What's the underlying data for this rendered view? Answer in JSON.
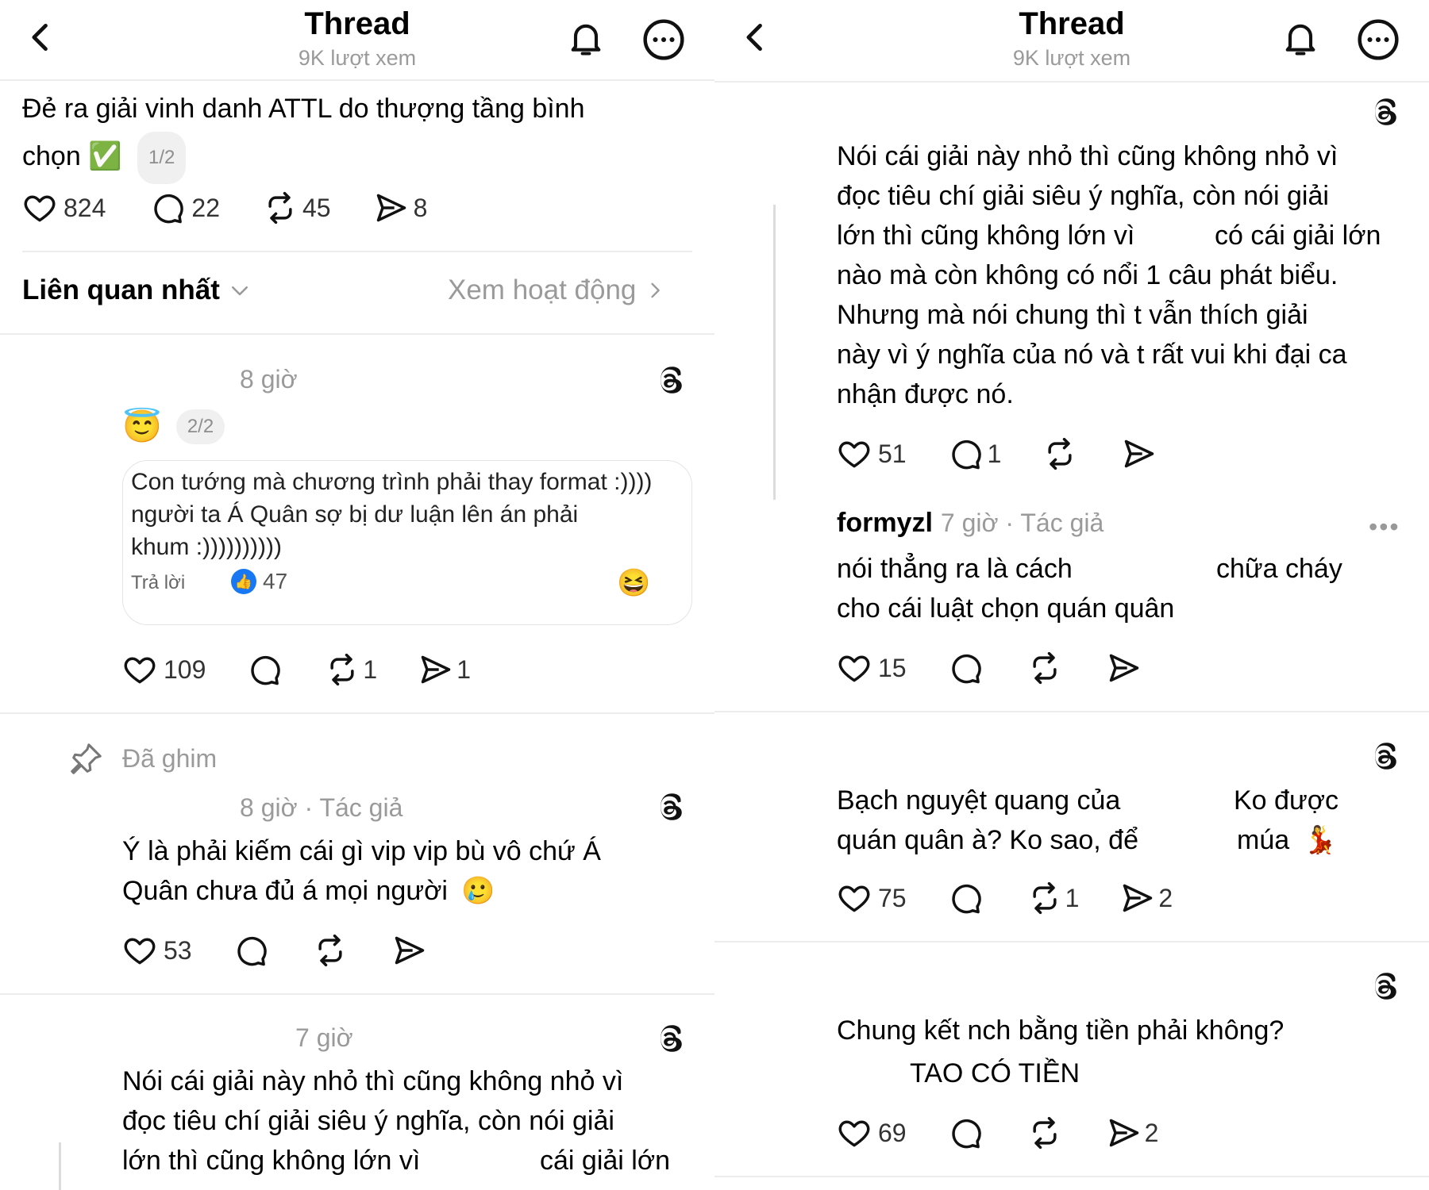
{
  "header": {
    "title": "Thread",
    "subtitle": "9K lượt xem"
  },
  "left": {
    "main_post": {
      "text_line1": "Đẻ ra giải vinh danh ATTL do thượng tầng bình",
      "text_line2": "chọn",
      "emoji": "✅",
      "page": "1/2",
      "likes": "824",
      "replies": "22",
      "reposts": "45",
      "shares": "8"
    },
    "sort": {
      "label": "Liên quan nhất",
      "activity": "Xem hoạt động"
    },
    "reply1": {
      "time": "8 giờ",
      "emoji": "😇",
      "page": "2/2",
      "card_lines": [
        "Con tướng mà chương trình phải thay format :))))",
        "người ta Á Quân sợ bị dư luận lên án phải",
        "khum :))))))))))"
      ],
      "card_reply_label": "Trả lời",
      "card_reaction_count": "47",
      "card_emoji": "😆",
      "likes": "109",
      "reposts": "1",
      "shares": "1"
    },
    "pinned": {
      "label": "Đã ghim",
      "time": "8 giờ · Tác giả",
      "text_lines": [
        "Ý là phải kiếm cái gì vip vip bù vô chứ Á",
        "Quân chưa đủ á mọi người"
      ],
      "emoji": "🥲",
      "likes": "53"
    },
    "reply3": {
      "time": "7 giờ",
      "text_lines": [
        "Nói cái giải này nhỏ thì cũng không nhỏ vì",
        "đọc tiêu chí giải siêu ý nghĩa, còn nói giải",
        "lớn thì cũng không lớn vì",
        "cái giải lớn"
      ]
    }
  },
  "right": {
    "post1": {
      "text_lines": [
        "Nói cái giải này nhỏ thì cũng không nhỏ vì",
        "đọc tiêu chí giải siêu ý nghĩa, còn nói giải",
        "lớn thì cũng không lớn vì",
        "có cái giải lớn",
        "nào mà còn không có nổi 1 câu phát biểu.",
        "Nhưng mà nói chung thì t vẫn thích giải",
        "này vì ý nghĩa của nó và t rất vui khi đại ca",
        "nhận được nó."
      ],
      "likes": "51",
      "replies": "1"
    },
    "post2": {
      "username": "formyzl",
      "meta": "7 giờ · Tác giả",
      "text_a": "nói thẳng ra là cách",
      "text_b": "chữa cháy",
      "text_line2": "cho cái luật chọn quán quân",
      "likes": "15"
    },
    "post3": {
      "text_a": "Bạch nguyệt quang của",
      "text_b": "Ko được",
      "text_c": "quán quân à? Ko sao, để",
      "text_d": "múa",
      "emoji": "💃",
      "likes": "75",
      "reposts": "1",
      "shares": "2"
    },
    "post4": {
      "text_line1": "Chung kết nch bằng tiền phải không?",
      "text_line2": "TAO CÓ TIỀN",
      "likes": "69",
      "shares": "2"
    }
  },
  "icons": {
    "back": "chevron-left-icon",
    "bell": "bell-icon",
    "more": "more-circle-icon",
    "heart": "heart-icon",
    "comment": "comment-icon",
    "repost": "repost-icon",
    "share": "send-icon",
    "threads": "threads-logo-icon",
    "pin": "pin-icon",
    "like_reaction": "thumbs-up-icon"
  },
  "colors": {
    "text": "#000000",
    "muted": "#9a9a9a",
    "divider": "#ececec",
    "reaction_blue": "#1877f2"
  }
}
